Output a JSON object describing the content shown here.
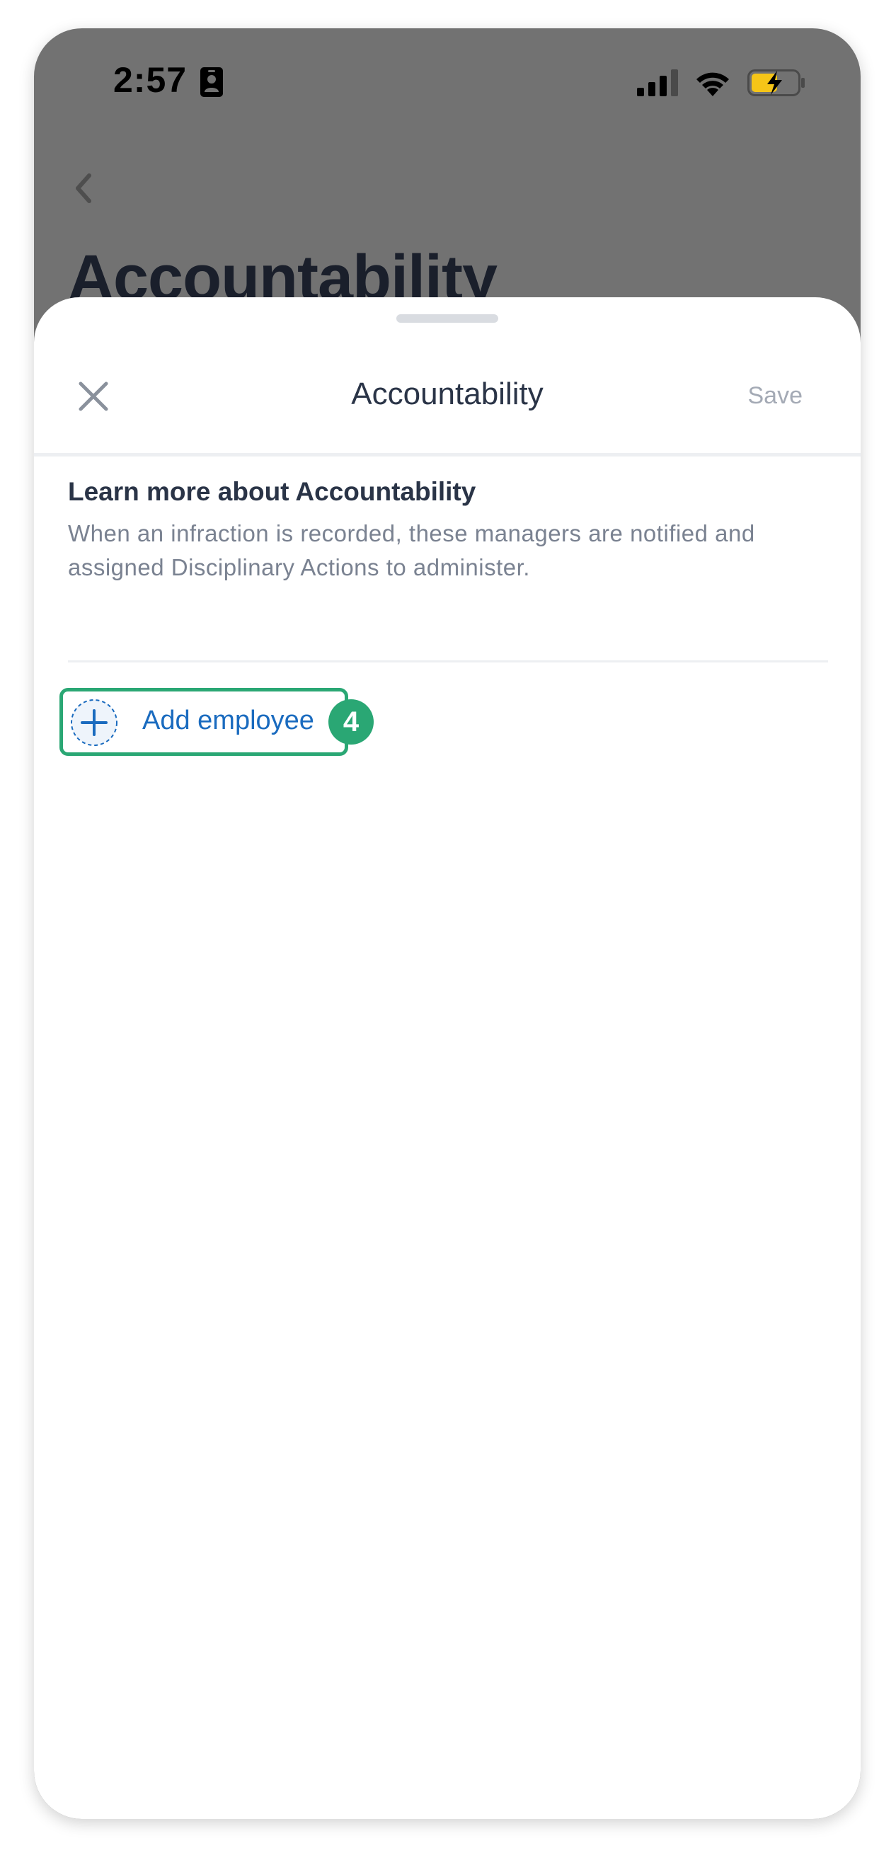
{
  "status_bar": {
    "time": "2:57",
    "icons": [
      "contact-card-icon",
      "cellular-signal-icon",
      "wifi-icon",
      "battery-charging-icon"
    ],
    "battery_color": "#f5c518"
  },
  "background_page": {
    "back_icon": "chevron-left-icon",
    "title": "Accountability"
  },
  "sheet": {
    "close_icon": "close-icon",
    "title": "Accountability",
    "save_label": "Save",
    "info_heading": "Learn more about Accountability",
    "info_text": "When an infraction is recorded, these managers are notified and assigned Disciplinary Actions to administer.",
    "add_employee_label": "Add employee",
    "add_icon": "plus-circle-icon",
    "step_badge": "4"
  },
  "colors": {
    "accent": "#1a6bbf",
    "highlight": "#2aa774",
    "overlay": "#727272"
  }
}
